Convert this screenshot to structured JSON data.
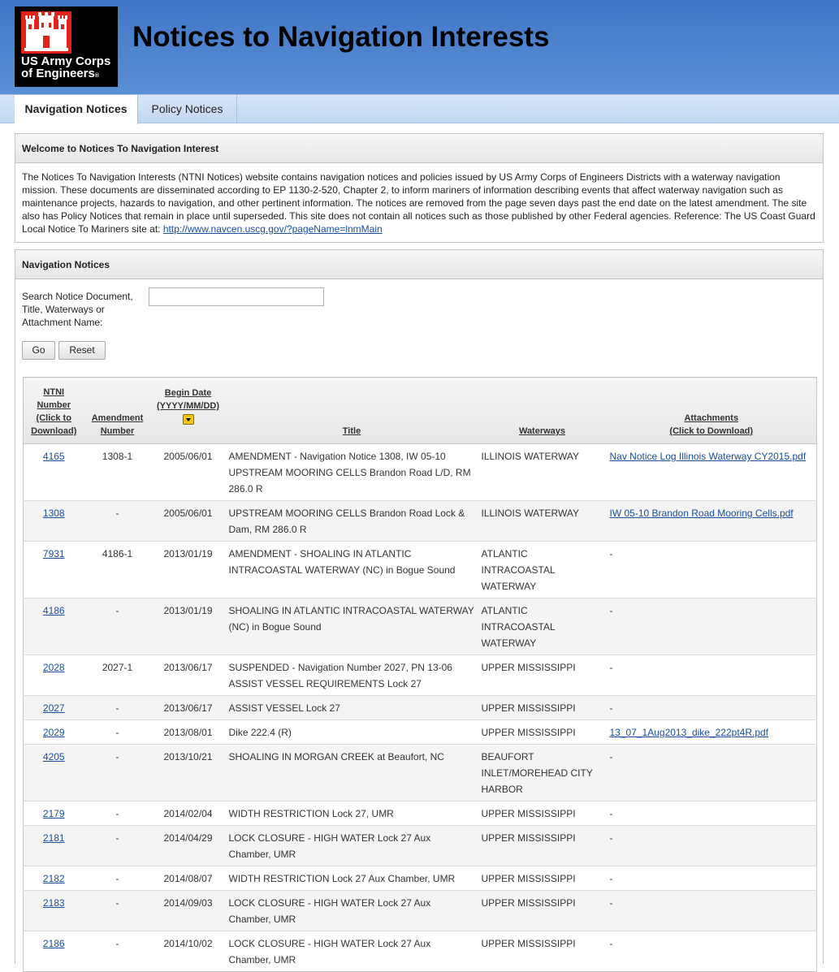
{
  "header": {
    "logo_line1": "US Army Corps",
    "logo_line2": "of Engineers",
    "title": "Notices to Navigation Interests"
  },
  "tabs": [
    {
      "label": "Navigation Notices",
      "active": true
    },
    {
      "label": "Policy Notices",
      "active": false
    }
  ],
  "welcome": {
    "heading": "Welcome to Notices To Navigation Interest",
    "body": "The Notices To Navigation Interests (NTNI Notices) website contains navigation notices and policies issued by US Army Corps of Engineers Districts with a waterway navigation mission. These documents are disseminated according to EP 1130-2-520, Chapter 2, to inform mariners of information describing events that affect waterway navigation such as maintenance projects, hazards to navigation, and other pertinent information. The notices are removed from the page seven days past the end date on the latest amendment. The site also has Policy Notices that remain in place until superseded. This site does not contain all notices such as those published by other Federal agencies. Reference: The US Coast Guard Local Notice To Mariners site at: ",
    "link": "http://www.navcen.uscg.gov/?pageName=lnmMain"
  },
  "notices": {
    "heading": "Navigation Notices",
    "search_label": "Search Notice Document, Title, Waterways or Attachment Name:",
    "search_value": "",
    "go_label": "Go",
    "reset_label": "Reset",
    "columns": {
      "ntni": [
        "NTNI",
        "Number",
        "(Click to",
        "Download)"
      ],
      "amendment": [
        "Amendment",
        "Number"
      ],
      "begin": [
        "Begin Date",
        "(YYYY/MM/DD)"
      ],
      "title": "Title",
      "waterways": "Waterways",
      "attachments": [
        "Attachments",
        "(Click to Download)"
      ]
    },
    "rows": [
      {
        "ntni": "4165",
        "amendment": "1308-1",
        "begin": "2005/06/01",
        "title": "AMENDMENT - Navigation Notice 1308, IW 05-10 UPSTREAM MOORING CELLS Brandon Road L/D, RM 286.0 R",
        "waterways": "ILLINOIS WATERWAY",
        "attachment": "Nav Notice Log Illinois Waterway CY2015.pdf"
      },
      {
        "ntni": "1308",
        "amendment": "-",
        "begin": "2005/06/01",
        "title": "UPSTREAM MOORING CELLS Brandon Road Lock & Dam, RM 286.0 R",
        "waterways": "ILLINOIS WATERWAY",
        "attachment": "IW 05-10 Brandon Road Mooring Cells.pdf"
      },
      {
        "ntni": "7931",
        "amendment": "4186-1",
        "begin": "2013/01/19",
        "title": "AMENDMENT - SHOALING IN ATLANTIC INTRACOASTAL WATERWAY (NC) in Bogue Sound",
        "waterways": "ATLANTIC INTRACOASTAL WATERWAY",
        "attachment": "-"
      },
      {
        "ntni": "4186",
        "amendment": "-",
        "begin": "2013/01/19",
        "title": "SHOALING IN ATLANTIC INTRACOASTAL WATERWAY (NC) in Bogue Sound",
        "waterways": "ATLANTIC INTRACOASTAL WATERWAY",
        "attachment": "-"
      },
      {
        "ntni": "2028",
        "amendment": "2027-1",
        "begin": "2013/06/17",
        "title": "SUSPENDED - Navigation Number 2027, PN 13-06 ASSIST VESSEL REQUIREMENTS Lock 27",
        "waterways": "UPPER MISSISSIPPI",
        "attachment": "-"
      },
      {
        "ntni": "2027",
        "amendment": "-",
        "begin": "2013/06/17",
        "title": "ASSIST VESSEL Lock 27",
        "waterways": "UPPER MISSISSIPPI",
        "attachment": "-"
      },
      {
        "ntni": "2029",
        "amendment": "-",
        "begin": "2013/08/01",
        "title": "Dike 222.4 (R)",
        "waterways": "UPPER MISSISSIPPI",
        "attachment": "13_07_1Aug2013_dike_222pt4R.pdf"
      },
      {
        "ntni": "4205",
        "amendment": "-",
        "begin": "2013/10/21",
        "title": "SHOALING IN MORGAN CREEK at Beaufort, NC",
        "waterways": "BEAUFORT INLET/MOREHEAD CITY HARBOR",
        "attachment": "-"
      },
      {
        "ntni": "2179",
        "amendment": "-",
        "begin": "2014/02/04",
        "title": "WIDTH RESTRICTION Lock 27, UMR",
        "waterways": "UPPER MISSISSIPPI",
        "attachment": "-"
      },
      {
        "ntni": "2181",
        "amendment": "-",
        "begin": "2014/04/29",
        "title": "LOCK CLOSURE - HIGH WATER Lock 27 Aux Chamber, UMR",
        "waterways": "UPPER MISSISSIPPI",
        "attachment": "-"
      },
      {
        "ntni": "2182",
        "amendment": "-",
        "begin": "2014/08/07",
        "title": "WIDTH RESTRICTION Lock 27 Aux Chamber, UMR",
        "waterways": "UPPER MISSISSIPPI",
        "attachment": "-"
      },
      {
        "ntni": "2183",
        "amendment": "-",
        "begin": "2014/09/03",
        "title": "LOCK CLOSURE - HIGH WATER Lock 27 Aux Chamber, UMR",
        "waterways": "UPPER MISSISSIPPI",
        "attachment": "-"
      },
      {
        "ntni": "2186",
        "amendment": "-",
        "begin": "2014/10/02",
        "title": "LOCK CLOSURE - HIGH WATER Lock 27 Aux Chamber, UMR",
        "waterways": "UPPER MISSISSIPPI",
        "attachment": "-"
      }
    ]
  },
  "icons": {
    "castle": "castle-logo-icon",
    "sort": "sort-descending-icon"
  },
  "colors": {
    "header_blue": "#3f76c6",
    "logo_red": "#e2231a",
    "link_blue": "#1a4fa0",
    "sort_yellow": "#f0c419"
  }
}
